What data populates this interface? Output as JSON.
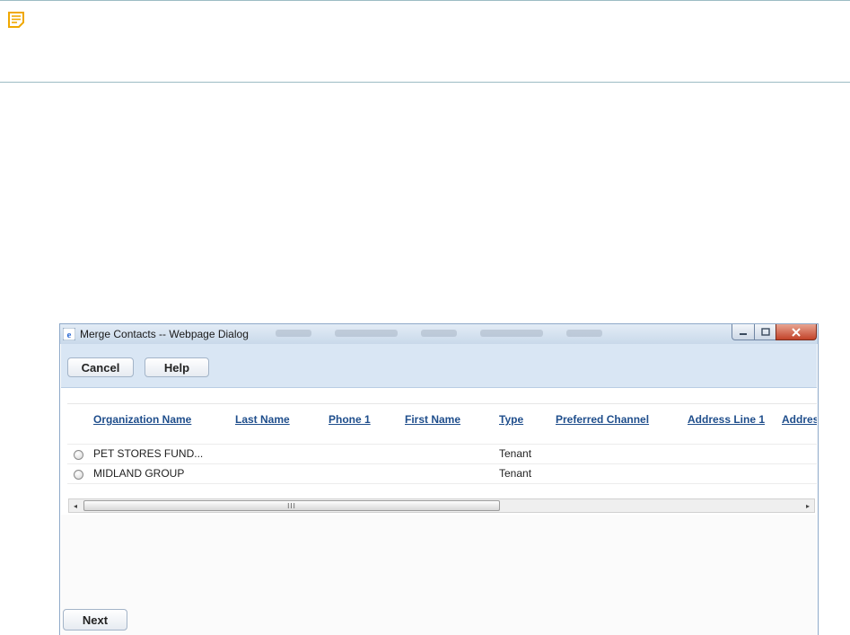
{
  "note": {
    "icon": "note-icon",
    "color": "#f5b800"
  },
  "dialog": {
    "title": "Merge Contacts -- Webpage Dialog",
    "icon": "ie-icon",
    "controls": {
      "minimize": "minimize-icon",
      "maximize": "maximize-icon",
      "close": "close-icon"
    }
  },
  "toolbar": {
    "cancel_label": "Cancel",
    "help_label": "Help"
  },
  "grid": {
    "columns": [
      "Organization Name",
      "Last Name",
      "Phone 1",
      "First Name",
      "Type",
      "Preferred Channel",
      "Address Line 1",
      "Addres"
    ],
    "rows": [
      {
        "organization": "PET STORES FUND...",
        "last_name": "",
        "phone": "",
        "first_name": "",
        "type": "Tenant",
        "channel": "",
        "address1": ""
      },
      {
        "organization": "MIDLAND GROUP",
        "last_name": "",
        "phone": "",
        "first_name": "",
        "type": "Tenant",
        "channel": "",
        "address1": ""
      }
    ]
  },
  "scrollbar": {
    "left_arrow": "◂",
    "right_arrow": "▸",
    "grip": "III"
  },
  "footer": {
    "next_label": "Next"
  },
  "colors": {
    "accent": "#1f4e8c",
    "toolbar": "#d9e6f4",
    "close": "#c2432a"
  }
}
